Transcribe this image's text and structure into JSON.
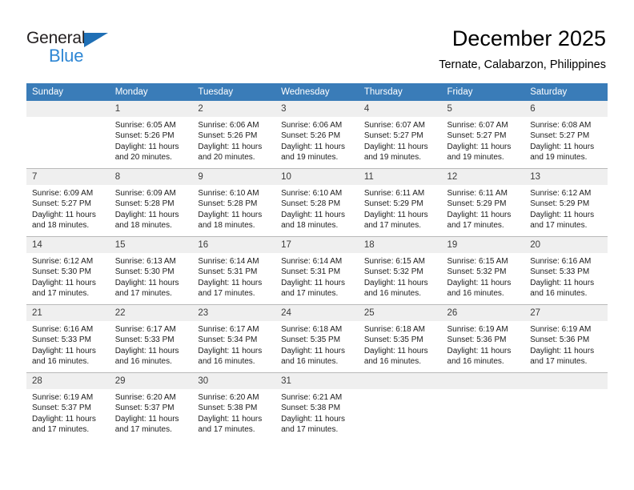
{
  "brand": {
    "name_dark": "General",
    "name_blue": "Blue",
    "dark_color": "#231f20",
    "blue_color": "#2f87d4",
    "triangle_color": "#1f6fb5"
  },
  "header": {
    "title": "December 2025",
    "subtitle": "Ternate, Calabarzon, Philippines",
    "header_bg": "#3a7cb8",
    "daynum_bg": "#efefef"
  },
  "weekdays": [
    "Sunday",
    "Monday",
    "Tuesday",
    "Wednesday",
    "Thursday",
    "Friday",
    "Saturday"
  ],
  "weeks": [
    [
      {
        "day": "",
        "lines": []
      },
      {
        "day": "1",
        "lines": [
          "Sunrise: 6:05 AM",
          "Sunset: 5:26 PM",
          "Daylight: 11 hours",
          "and 20 minutes."
        ]
      },
      {
        "day": "2",
        "lines": [
          "Sunrise: 6:06 AM",
          "Sunset: 5:26 PM",
          "Daylight: 11 hours",
          "and 20 minutes."
        ]
      },
      {
        "day": "3",
        "lines": [
          "Sunrise: 6:06 AM",
          "Sunset: 5:26 PM",
          "Daylight: 11 hours",
          "and 19 minutes."
        ]
      },
      {
        "day": "4",
        "lines": [
          "Sunrise: 6:07 AM",
          "Sunset: 5:27 PM",
          "Daylight: 11 hours",
          "and 19 minutes."
        ]
      },
      {
        "day": "5",
        "lines": [
          "Sunrise: 6:07 AM",
          "Sunset: 5:27 PM",
          "Daylight: 11 hours",
          "and 19 minutes."
        ]
      },
      {
        "day": "6",
        "lines": [
          "Sunrise: 6:08 AM",
          "Sunset: 5:27 PM",
          "Daylight: 11 hours",
          "and 19 minutes."
        ]
      }
    ],
    [
      {
        "day": "7",
        "lines": [
          "Sunrise: 6:09 AM",
          "Sunset: 5:27 PM",
          "Daylight: 11 hours",
          "and 18 minutes."
        ]
      },
      {
        "day": "8",
        "lines": [
          "Sunrise: 6:09 AM",
          "Sunset: 5:28 PM",
          "Daylight: 11 hours",
          "and 18 minutes."
        ]
      },
      {
        "day": "9",
        "lines": [
          "Sunrise: 6:10 AM",
          "Sunset: 5:28 PM",
          "Daylight: 11 hours",
          "and 18 minutes."
        ]
      },
      {
        "day": "10",
        "lines": [
          "Sunrise: 6:10 AM",
          "Sunset: 5:28 PM",
          "Daylight: 11 hours",
          "and 18 minutes."
        ]
      },
      {
        "day": "11",
        "lines": [
          "Sunrise: 6:11 AM",
          "Sunset: 5:29 PM",
          "Daylight: 11 hours",
          "and 17 minutes."
        ]
      },
      {
        "day": "12",
        "lines": [
          "Sunrise: 6:11 AM",
          "Sunset: 5:29 PM",
          "Daylight: 11 hours",
          "and 17 minutes."
        ]
      },
      {
        "day": "13",
        "lines": [
          "Sunrise: 6:12 AM",
          "Sunset: 5:29 PM",
          "Daylight: 11 hours",
          "and 17 minutes."
        ]
      }
    ],
    [
      {
        "day": "14",
        "lines": [
          "Sunrise: 6:12 AM",
          "Sunset: 5:30 PM",
          "Daylight: 11 hours",
          "and 17 minutes."
        ]
      },
      {
        "day": "15",
        "lines": [
          "Sunrise: 6:13 AM",
          "Sunset: 5:30 PM",
          "Daylight: 11 hours",
          "and 17 minutes."
        ]
      },
      {
        "day": "16",
        "lines": [
          "Sunrise: 6:14 AM",
          "Sunset: 5:31 PM",
          "Daylight: 11 hours",
          "and 17 minutes."
        ]
      },
      {
        "day": "17",
        "lines": [
          "Sunrise: 6:14 AM",
          "Sunset: 5:31 PM",
          "Daylight: 11 hours",
          "and 17 minutes."
        ]
      },
      {
        "day": "18",
        "lines": [
          "Sunrise: 6:15 AM",
          "Sunset: 5:32 PM",
          "Daylight: 11 hours",
          "and 16 minutes."
        ]
      },
      {
        "day": "19",
        "lines": [
          "Sunrise: 6:15 AM",
          "Sunset: 5:32 PM",
          "Daylight: 11 hours",
          "and 16 minutes."
        ]
      },
      {
        "day": "20",
        "lines": [
          "Sunrise: 6:16 AM",
          "Sunset: 5:33 PM",
          "Daylight: 11 hours",
          "and 16 minutes."
        ]
      }
    ],
    [
      {
        "day": "21",
        "lines": [
          "Sunrise: 6:16 AM",
          "Sunset: 5:33 PM",
          "Daylight: 11 hours",
          "and 16 minutes."
        ]
      },
      {
        "day": "22",
        "lines": [
          "Sunrise: 6:17 AM",
          "Sunset: 5:33 PM",
          "Daylight: 11 hours",
          "and 16 minutes."
        ]
      },
      {
        "day": "23",
        "lines": [
          "Sunrise: 6:17 AM",
          "Sunset: 5:34 PM",
          "Daylight: 11 hours",
          "and 16 minutes."
        ]
      },
      {
        "day": "24",
        "lines": [
          "Sunrise: 6:18 AM",
          "Sunset: 5:35 PM",
          "Daylight: 11 hours",
          "and 16 minutes."
        ]
      },
      {
        "day": "25",
        "lines": [
          "Sunrise: 6:18 AM",
          "Sunset: 5:35 PM",
          "Daylight: 11 hours",
          "and 16 minutes."
        ]
      },
      {
        "day": "26",
        "lines": [
          "Sunrise: 6:19 AM",
          "Sunset: 5:36 PM",
          "Daylight: 11 hours",
          "and 16 minutes."
        ]
      },
      {
        "day": "27",
        "lines": [
          "Sunrise: 6:19 AM",
          "Sunset: 5:36 PM",
          "Daylight: 11 hours",
          "and 17 minutes."
        ]
      }
    ],
    [
      {
        "day": "28",
        "lines": [
          "Sunrise: 6:19 AM",
          "Sunset: 5:37 PM",
          "Daylight: 11 hours",
          "and 17 minutes."
        ]
      },
      {
        "day": "29",
        "lines": [
          "Sunrise: 6:20 AM",
          "Sunset: 5:37 PM",
          "Daylight: 11 hours",
          "and 17 minutes."
        ]
      },
      {
        "day": "30",
        "lines": [
          "Sunrise: 6:20 AM",
          "Sunset: 5:38 PM",
          "Daylight: 11 hours",
          "and 17 minutes."
        ]
      },
      {
        "day": "31",
        "lines": [
          "Sunrise: 6:21 AM",
          "Sunset: 5:38 PM",
          "Daylight: 11 hours",
          "and 17 minutes."
        ]
      },
      {
        "day": "",
        "lines": []
      },
      {
        "day": "",
        "lines": []
      },
      {
        "day": "",
        "lines": []
      }
    ]
  ]
}
